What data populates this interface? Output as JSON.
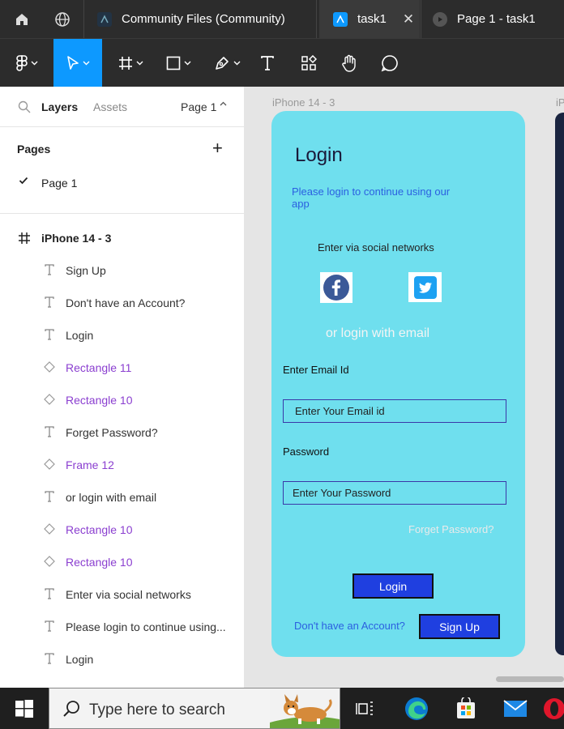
{
  "tabs": [
    {
      "label": "Community Files (Community)",
      "active": false
    },
    {
      "label": "task1",
      "active": true
    },
    {
      "label": "Page 1 - task1",
      "active": false
    }
  ],
  "left_panel": {
    "tab_layers": "Layers",
    "tab_assets": "Assets",
    "page_selector": "Page 1",
    "pages_header": "Pages",
    "pages": [
      "Page 1"
    ],
    "frame_name": "iPhone 14 - 3",
    "layers": [
      {
        "name": "Sign Up",
        "type": "text"
      },
      {
        "name": "Don't have an Account?",
        "type": "text"
      },
      {
        "name": "Login",
        "type": "text"
      },
      {
        "name": "Rectangle 11",
        "type": "component"
      },
      {
        "name": "Rectangle 10",
        "type": "component"
      },
      {
        "name": "Forget Password?",
        "type": "text"
      },
      {
        "name": "Frame 12",
        "type": "component"
      },
      {
        "name": "or login with email",
        "type": "text"
      },
      {
        "name": "Rectangle 10",
        "type": "component"
      },
      {
        "name": "Rectangle 10",
        "type": "component"
      },
      {
        "name": "Enter via social networks",
        "type": "text"
      },
      {
        "name": "Please login to continue using...",
        "type": "text"
      },
      {
        "name": "Login",
        "type": "text"
      }
    ]
  },
  "canvas": {
    "frame_label": "iPhone 14 - 3",
    "frame_label_2": "iP",
    "login_title": "Login",
    "subtitle": "Please login to continue using our app",
    "social_title": "Enter via social networks",
    "or_login": "or login with email",
    "email_label": "Enter Email Id",
    "email_placeholder": "Enter Your Email id",
    "password_label": "Password",
    "password_placeholder": "Enter Your Password",
    "forgot": "Forget Password?",
    "login_button": "Login",
    "no_account": "Don't have an Account?",
    "signup_button": "Sign Up"
  },
  "taskbar": {
    "search_placeholder": "Type here to search"
  },
  "colors": {
    "accent": "#0d99ff",
    "phone_bg": "#6fdfee",
    "button_bg": "#1f3fe0",
    "component": "#8b3fd0"
  }
}
